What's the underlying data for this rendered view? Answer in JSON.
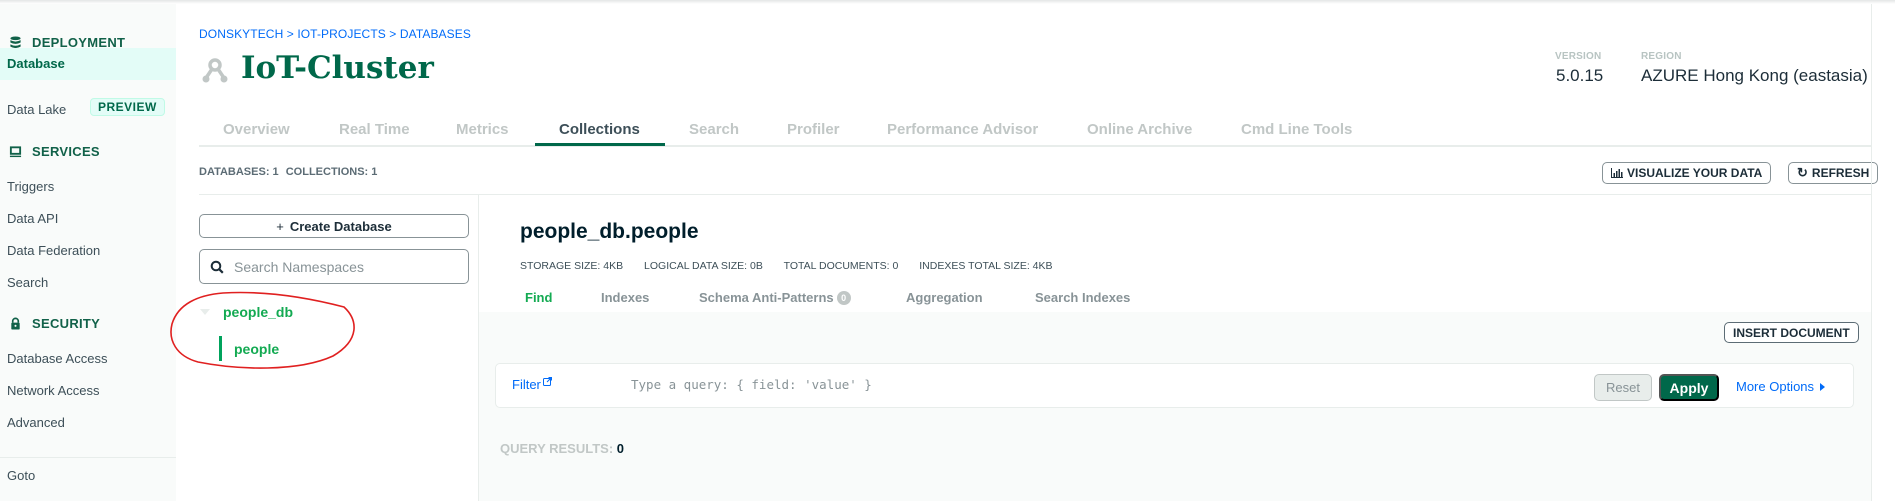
{
  "sidebar": {
    "sections": [
      {
        "label": "DEPLOYMENT",
        "icon": "database-stack-icon"
      },
      {
        "label": "SERVICES",
        "icon": "monitor-icon"
      },
      {
        "label": "SECURITY",
        "icon": "lock-icon"
      }
    ],
    "items": {
      "database": "Database",
      "data_lake": "Data Lake",
      "data_lake_badge": "PREVIEW",
      "triggers": "Triggers",
      "data_api": "Data API",
      "data_federation": "Data Federation",
      "search": "Search",
      "database_access": "Database Access",
      "network_access": "Network Access",
      "advanced": "Advanced",
      "goto": "Goto"
    }
  },
  "header": {
    "breadcrumb": "DONSKYTECH > IOT-PROJECTS > DATABASES",
    "cluster_name": "IoT-Cluster",
    "version_label": "VERSION",
    "version_value": "5.0.15",
    "region_label": "REGION",
    "region_value": "AZURE Hong Kong (eastasia)"
  },
  "tabs": [
    "Overview",
    "Real Time",
    "Metrics",
    "Collections",
    "Search",
    "Profiler",
    "Performance Advisor",
    "Online Archive",
    "Cmd Line Tools"
  ],
  "active_tab": "Collections",
  "summary": {
    "databases": "DATABASES: 1",
    "collections": "COLLECTIONS: 1",
    "visualize_label": "VISUALIZE YOUR DATA",
    "refresh_label": "REFRESH"
  },
  "namespace_panel": {
    "create_database_label": "Create Database",
    "search_placeholder": "Search Namespaces",
    "database": "people_db",
    "collection": "people"
  },
  "collection": {
    "title": "people_db.people",
    "stats": {
      "storage_size": "STORAGE SIZE: 4KB",
      "logical_data_size": "LOGICAL DATA SIZE: 0B",
      "total_documents": "TOTAL DOCUMENTS: 0",
      "indexes_total_size": "INDEXES TOTAL SIZE: 4KB"
    },
    "sub_tabs": [
      "Find",
      "Indexes",
      "Schema Anti-Patterns",
      "Aggregation",
      "Search Indexes"
    ],
    "schema_anti_patterns_count": "0",
    "active_sub_tab": "Find",
    "insert_document_label": "INSERT DOCUMENT",
    "filter_label": "Filter",
    "filter_placeholder": "Type a query: { field: 'value' }",
    "filter_value": "",
    "reset_label": "Reset",
    "apply_label": "Apply",
    "more_options_label": "More Options",
    "query_results_label": "QUERY RESULTS:",
    "query_results_value": "0"
  },
  "colors": {
    "brand_green": "#00684a",
    "link_blue": "#016bf8",
    "namespace_green": "#13aa52",
    "annotation_red": "#e02020"
  }
}
